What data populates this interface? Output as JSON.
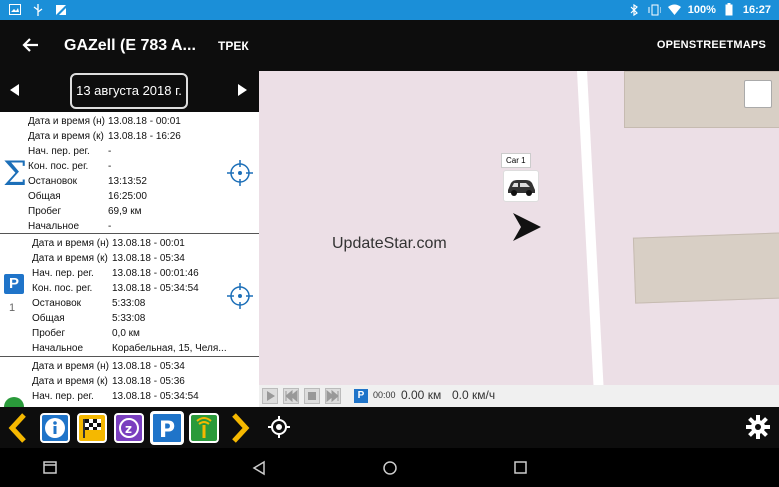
{
  "status_bar": {
    "battery": "100%",
    "time": "16:27",
    "left_icons": [
      "image-icon",
      "usb-icon",
      "app-icon"
    ],
    "right_icons": [
      "bluetooth-icon",
      "vibrate-icon",
      "wifi-icon",
      "battery-icon"
    ]
  },
  "toolbar": {
    "title": "GAZell (E 783 A...",
    "trek_label": "ТРЕК",
    "map_source_label": "OPENSTREETMAPS"
  },
  "date_nav": {
    "date": "13 августа 2018 г."
  },
  "summary_card": {
    "rows": [
      {
        "label": "Дата и время (н)",
        "value": "13.08.18 - 00:01"
      },
      {
        "label": "Дата и время (к)",
        "value": "13.08.18 - 16:26"
      },
      {
        "label": "Нач. пер. рег.",
        "value": "-"
      },
      {
        "label": "Кон. пос. рег.",
        "value": "-"
      },
      {
        "label": "Остановок",
        "value": "13:13:52"
      },
      {
        "label": "Общая",
        "value": "16:25:00"
      },
      {
        "label": "Пробег",
        "value": "69,9 км"
      },
      {
        "label": "Начальное",
        "value": "-"
      }
    ]
  },
  "parking_card": {
    "icon_letter": "P",
    "index": "1",
    "rows": [
      {
        "label": "Дата и время (н)",
        "value": "13.08.18 - 00:01"
      },
      {
        "label": "Дата и время (к)",
        "value": "13.08.18 - 05:34"
      },
      {
        "label": "Нач. пер. рег.",
        "value": "13.08.18 - 00:01:46"
      },
      {
        "label": "Кон. пос. рег.",
        "value": "13.08.18 - 05:34:54"
      },
      {
        "label": "Остановок",
        "value": "5:33:08"
      },
      {
        "label": "Общая",
        "value": "5:33:08"
      },
      {
        "label": "Пробег",
        "value": "0,0 км"
      },
      {
        "label": "Начальное",
        "value": "Корабельная, 15, Челя..."
      }
    ]
  },
  "third_card": {
    "rows": [
      {
        "label": "Дата и время (н)",
        "value": "13.08.18 - 05:34"
      },
      {
        "label": "Дата и время (к)",
        "value": "13.08.18 - 05:36"
      },
      {
        "label": "Нач. пер. рег.",
        "value": "13.08.18 - 05:34:54"
      }
    ]
  },
  "map": {
    "car_label": "Car 1",
    "watermark": "UpdateStar.com"
  },
  "player": {
    "time": "00:00",
    "distance": "0.00 км",
    "speed": "0.0 км/ч",
    "marker_letter": "P"
  },
  "colors": {
    "status_bar": "#1b8fd8",
    "app_bar": "#0d0d0d",
    "accent_yellow": "#f5b800",
    "parking_blue": "#1f74c9"
  }
}
